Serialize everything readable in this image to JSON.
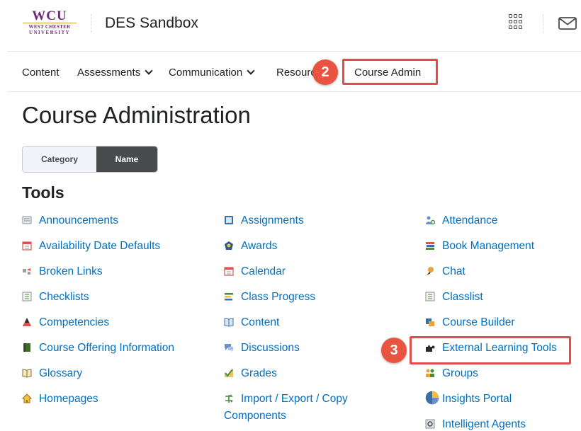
{
  "header": {
    "logo_text": "WCU",
    "logo_sub1": "WEST CHESTER",
    "logo_sub2": "UNIVERSITY",
    "site_title": "DES Sandbox"
  },
  "nav": {
    "items": [
      {
        "label": "Content",
        "dropdown": false
      },
      {
        "label": "Assessments",
        "dropdown": true
      },
      {
        "label": "Communication",
        "dropdown": true
      },
      {
        "label": "Resources",
        "dropdown": false
      },
      {
        "label": "Course Admin",
        "dropdown": false
      }
    ],
    "callout_label": "2"
  },
  "page": {
    "title": "Course Administration",
    "toggle": {
      "category_label": "Category",
      "name_label": "Name",
      "selected": "Name"
    },
    "section_title": "Tools"
  },
  "tools": {
    "col1": [
      "Announcements",
      "Availability Date Defaults",
      "Broken Links",
      "Checklists",
      "Competencies",
      "Course Offering Information",
      "Glossary",
      "Homepages"
    ],
    "col2": [
      "Assignments",
      "Awards",
      "Calendar",
      "Class Progress",
      "Content",
      "Discussions",
      "Grades",
      "Import / Export / Copy Components"
    ],
    "col3": [
      "Attendance",
      "Book Management",
      "Chat",
      "Classlist",
      "Course Builder",
      "External Learning Tools",
      "Groups",
      "Insights Portal",
      "Intelligent Agents"
    ],
    "callout_label": "3"
  },
  "colors": {
    "link": "#006fbf",
    "callout": "#e8543f",
    "highlight_border": "#e24c4c",
    "toggle_selected": "#494c4e"
  }
}
